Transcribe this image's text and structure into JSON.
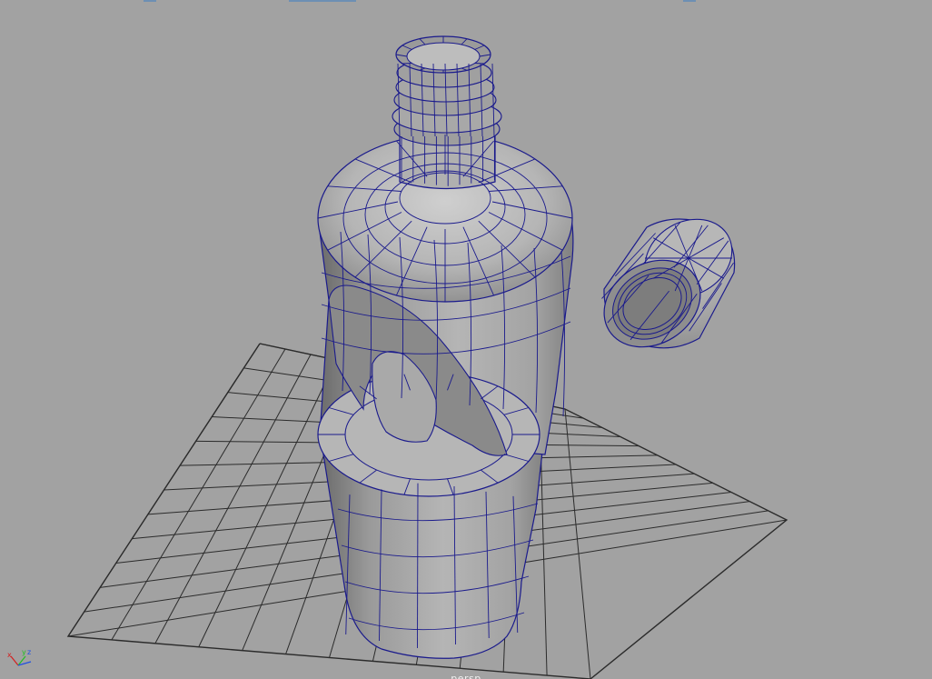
{
  "viewport": {
    "camera_name": "persp",
    "background_color": "#a2a2a2",
    "wire_color": "#1a1a8c",
    "grid_color": "#2b2b2b"
  },
  "axis_gizmo": {
    "x_label": "x",
    "y_label": "y",
    "z_label": "z",
    "x_color": "#d42020",
    "y_color": "#20c020",
    "z_color": "#2050e0"
  },
  "objects": [
    {
      "name": "bottle",
      "kind": "polygon-mesh"
    },
    {
      "name": "cap",
      "kind": "polygon-mesh"
    }
  ]
}
